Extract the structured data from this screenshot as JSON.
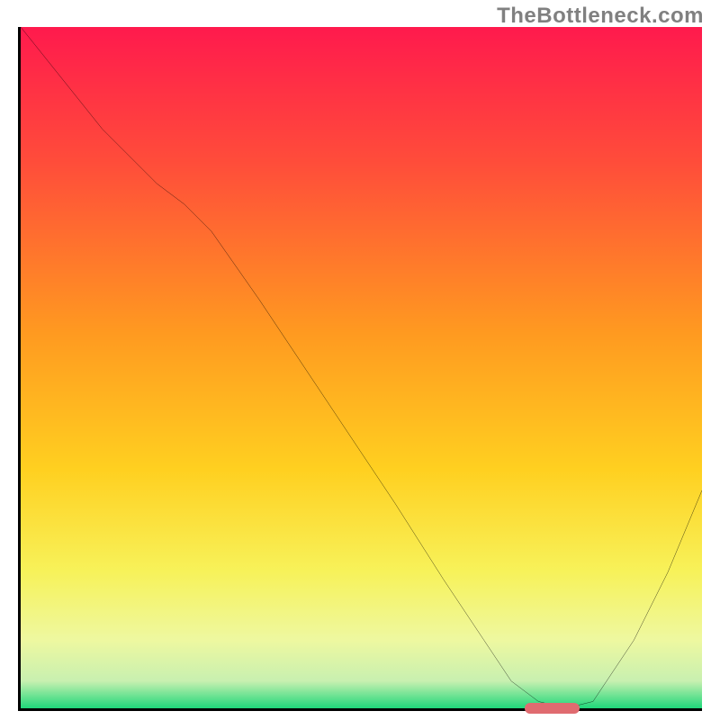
{
  "watermark": {
    "text": "TheBottleneck.com"
  },
  "chart_data": {
    "type": "line",
    "title": "",
    "xlabel": "",
    "ylabel": "",
    "x_range": [
      0,
      100
    ],
    "y_range": [
      0,
      100
    ],
    "series": [
      {
        "name": "curve",
        "x": [
          0,
          4,
          12,
          20,
          24,
          28,
          35,
          45,
          55,
          62,
          68,
          72,
          76,
          80,
          84,
          90,
          95,
          100
        ],
        "y": [
          100,
          95,
          85,
          77,
          74,
          70,
          60,
          45,
          30,
          19,
          10,
          4,
          1,
          0,
          1,
          10,
          20,
          32
        ]
      }
    ],
    "marker": {
      "name": "optimal-range",
      "x_start": 74,
      "x_end": 82,
      "y": 0
    },
    "gradient_stops": [
      {
        "offset": 0.0,
        "color": "#ff1a4d"
      },
      {
        "offset": 0.2,
        "color": "#ff4d3a"
      },
      {
        "offset": 0.45,
        "color": "#ff9a20"
      },
      {
        "offset": 0.65,
        "color": "#ffd020"
      },
      {
        "offset": 0.8,
        "color": "#f7f25a"
      },
      {
        "offset": 0.9,
        "color": "#eef8a0"
      },
      {
        "offset": 0.96,
        "color": "#c8f0b0"
      },
      {
        "offset": 1.0,
        "color": "#1fd77a"
      }
    ]
  }
}
